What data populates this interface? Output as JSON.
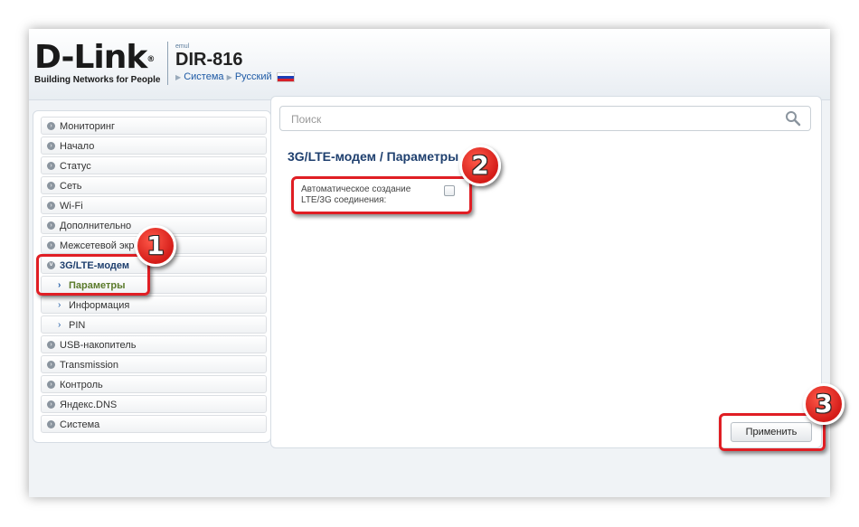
{
  "header": {
    "logo_text": "D-Link",
    "logo_reg": "®",
    "logo_tagline": "Building Networks for People",
    "emul": "emul",
    "model": "DIR-816",
    "crumb_system": "Система",
    "crumb_language": "Русский"
  },
  "sidebar": {
    "items": [
      {
        "label": "Мониторинг"
      },
      {
        "label": "Начало"
      },
      {
        "label": "Статус"
      },
      {
        "label": "Сеть"
      },
      {
        "label": "Wi-Fi"
      },
      {
        "label": "Дополнительно"
      },
      {
        "label": "Межсетевой экран"
      },
      {
        "label": "3G/LTE-модем"
      },
      {
        "label": "Параметры"
      },
      {
        "label": "Информация"
      },
      {
        "label": "PIN"
      },
      {
        "label": "USB-накопитель"
      },
      {
        "label": "Transmission"
      },
      {
        "label": "Контроль"
      },
      {
        "label": "Яндекс.DNS"
      },
      {
        "label": "Система"
      }
    ]
  },
  "search": {
    "placeholder": "Поиск"
  },
  "main": {
    "title": "3G/LTE-модем /  Параметры",
    "auto_connect_label": "Автоматическое создание LTE/3G соединения:",
    "apply_label": "Применить"
  },
  "badges": [
    "1",
    "2",
    "3"
  ],
  "colors": {
    "accent_red": "#e01e24",
    "title_blue": "#1e3f6e",
    "link_blue": "#1e5aa5"
  }
}
